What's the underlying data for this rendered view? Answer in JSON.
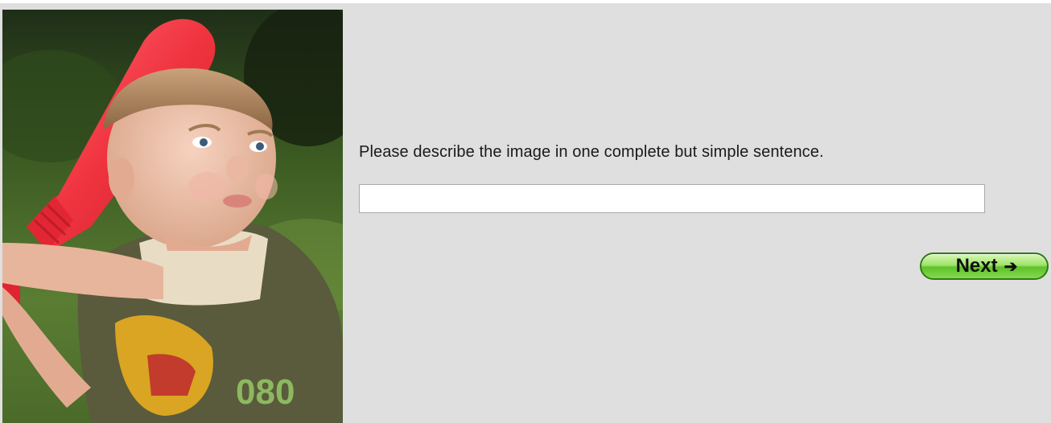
{
  "photo": {
    "description_icon": "child-batting-photo"
  },
  "task": {
    "prompt": "Please describe the image in one complete but simple sentence.",
    "answer_value": "",
    "answer_placeholder": ""
  },
  "navigation": {
    "next_label": "Next",
    "next_arrow": "➔"
  },
  "colors": {
    "background": "#dfdfdf",
    "button_green": "#6fcf3a",
    "button_border": "#2f7d12"
  }
}
